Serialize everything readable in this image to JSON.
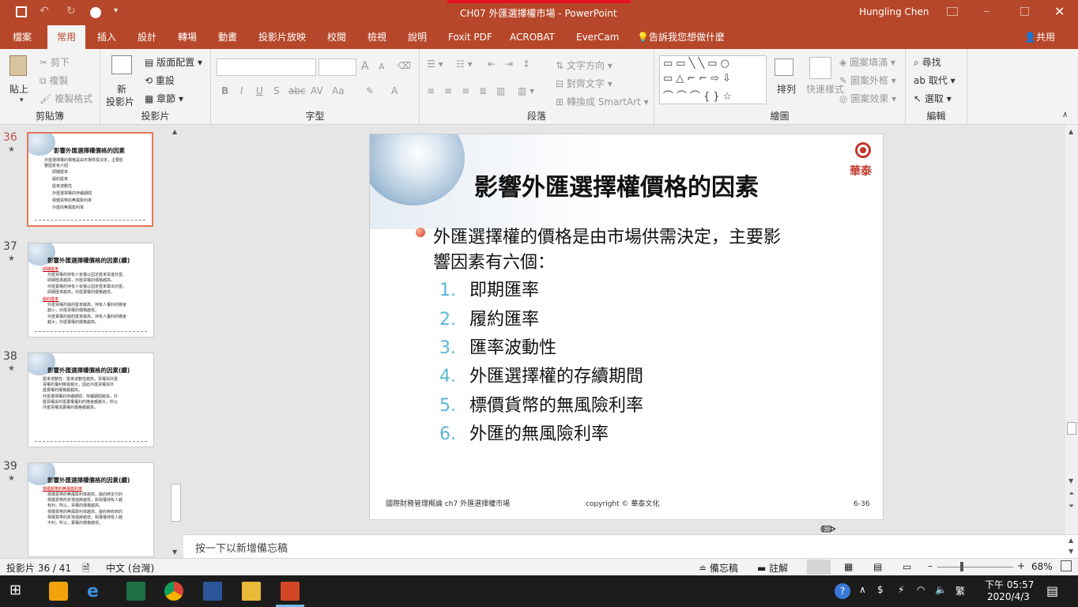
{
  "title_bar": {
    "document_title": "CH07 外匯選擇權市場 - PowerPoint",
    "user": "Hungling Chen"
  },
  "tabs": [
    "檔案",
    "常用",
    "插入",
    "設計",
    "轉場",
    "動畫",
    "投影片放映",
    "校閱",
    "檢視",
    "說明",
    "Foxit PDF",
    "ACROBAT",
    "EverCam"
  ],
  "active_tab": "常用",
  "tell_me": "告訴我您想做什麼",
  "share": "共用",
  "ribbon": {
    "clipboard": {
      "paste": "貼上",
      "cut": "剪下",
      "copy": "複製",
      "format_painter": "複製格式",
      "name": "剪貼簿"
    },
    "slides": {
      "new_slide": "新",
      "new_slide2": "投影片",
      "layout": "版面配置",
      "reset": "重設",
      "section": "章節",
      "name": "投影片"
    },
    "font": {
      "name": "字型",
      "bold": "B",
      "italic": "I",
      "underline": "U",
      "strike": "S",
      "abc": "abc",
      "av": "AV",
      "aa": "Aa",
      "a": "A",
      "grow": "A",
      "shrink": "A"
    },
    "paragraph": {
      "name": "段落",
      "text_direction": "文字方向",
      "align_text": "對齊文字",
      "smartart": "轉換成 SmartArt"
    },
    "drawing": {
      "name": "繪圖",
      "arrange": "排列",
      "quick_styles": "快速樣式",
      "shape_fill": "圖案填滿",
      "shape_outline": "圖案外框",
      "shape_effects": "圖案效果"
    },
    "editing": {
      "name": "編輯",
      "find": "尋找",
      "replace": "取代",
      "select": "選取"
    }
  },
  "thumbnails": [
    {
      "num": "36",
      "title": "影響外匯選擇權價格的因素",
      "lines": [
        "外匯選擇權的價格是由市場供需決定，主要影",
        "響因素有六個：",
        "即期匯率",
        "履約匯率",
        "匯率波動性",
        "外匯選擇權的存續期間",
        "標價貨幣的無風險利率",
        "外匯的無風險利率"
      ]
    },
    {
      "num": "37",
      "title": "影響外匯選擇權價格的因素(續)",
      "lines": [
        "即期匯率",
        "外匯買權的持有人有權以固定匯率買進外匯，",
        "即期匯率越高，外匯買權的價格越高。",
        "外匯賣權的持有人有權以固定匯率賣出外匯，",
        "即期匯率越高，外匯賣權的價格越低。",
        "履約匯率",
        "外匯買權的履約匯率越高，持有人獲利的機會",
        "越小，外匯買權的價格越低。",
        "外匯賣權的履約匯率越高，持有人獲利的機會",
        "越大，外匯賣權的價格越高。"
      ]
    },
    {
      "num": "38",
      "title": "影響外匯選擇權價格的因素(續)",
      "lines": [
        "匯率波動性：匯率波動性越高，買權與外匯",
        "買權的獲利機會越大，因此外匯買權與外",
        "匯賣權的價格都越高。",
        "外匯選擇權的存續期間：存續期間越長，外",
        "匯買權與外匯賣權獲利的機會都越大，所以",
        "外匯買權與賣權的價格都越高。"
      ]
    },
    {
      "num": "39",
      "title": "影響外匯選擇權價格的因素(續)",
      "lines": [
        "標價貨幣的無風險利率",
        "標價貨幣的無風險利率越高，履約時支付的",
        "標價貨幣的折現值將越低，對買權持有人越",
        "有利，所以，買權的價格越高。",
        "標價貨幣的無風險利率越高，履約時收到的",
        "標價貨幣的折現值將越低，對賣權持有人越",
        "不利，所以，賣權的價格越低。"
      ]
    }
  ],
  "slide": {
    "title": "影響外匯選擇權價格的因素",
    "logo_text": "華泰",
    "bullet": [
      "外匯選擇權的價格是由市場供需決定，主要影",
      "響因素有六個："
    ],
    "items": [
      {
        "n": "1.",
        "t": "即期匯率"
      },
      {
        "n": "2.",
        "t": "履約匯率"
      },
      {
        "n": "3.",
        "t": "匯率波動性"
      },
      {
        "n": "4.",
        "t": "外匯選擇權的存續期間"
      },
      {
        "n": "5.",
        "t": "標價貨幣的無風險利率"
      },
      {
        "n": "6.",
        "t": "外匯的無風險利率"
      }
    ],
    "footer_left": "國際財務管理概論 ch7 外匯選擇權市場",
    "footer_center": "copyright © 華泰文化",
    "footer_right": "6-36"
  },
  "notes_placeholder": "按一下以新增備忘稿",
  "status": {
    "slide_count": "投影片 36 / 41",
    "language": "中文 (台灣)",
    "notes": "備忘稿",
    "comments": "註解",
    "zoom": "68%"
  },
  "taskbar": {
    "ime": "繁",
    "time": "下午 05:57",
    "date": "2020/4/3"
  }
}
